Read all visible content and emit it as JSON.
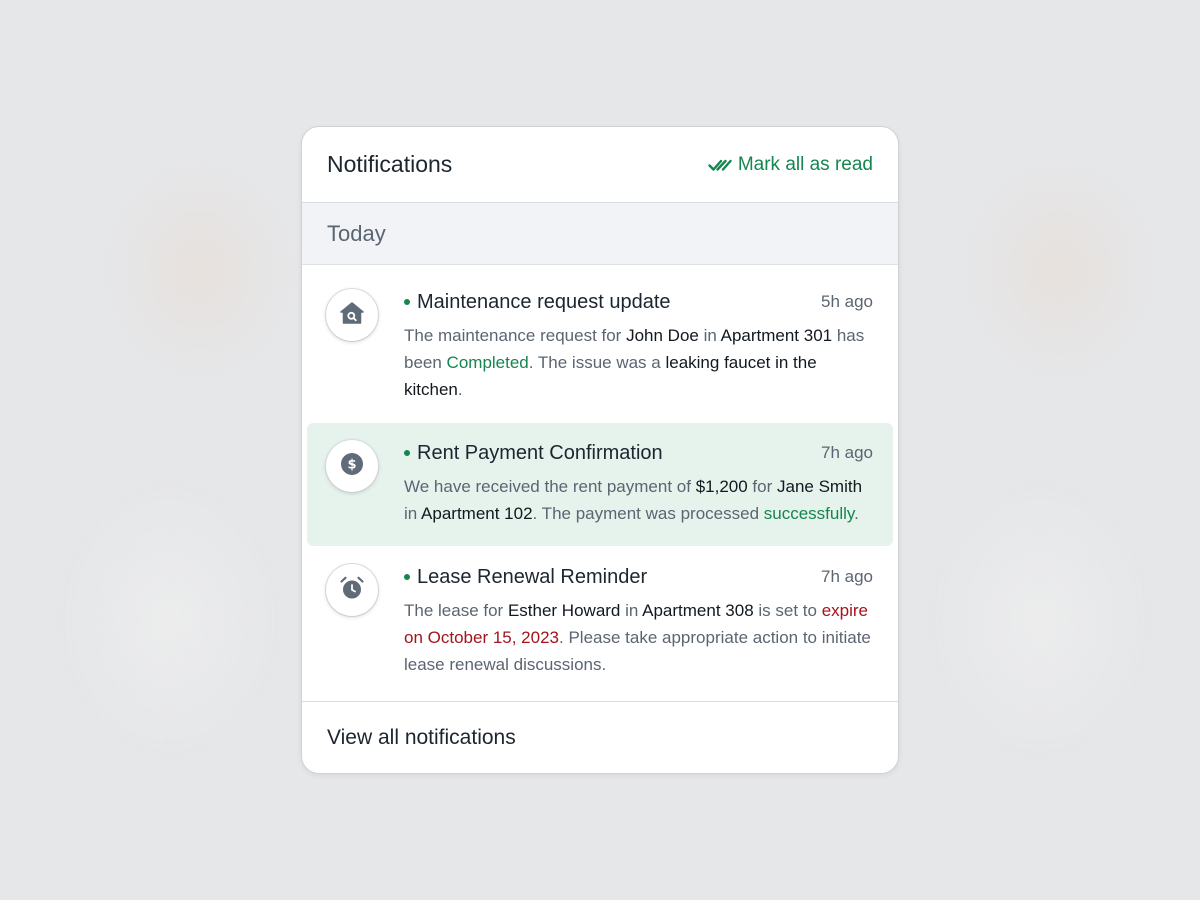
{
  "header": {
    "title": "Notifications",
    "mark_all_label": "Mark all as read"
  },
  "section": {
    "label": "Today"
  },
  "notifications": [
    {
      "icon": "home-search-icon",
      "title": "Maintenance request update",
      "time": "5h ago",
      "unread": true,
      "highlighted": false,
      "body": [
        {
          "text": "The maintenance request for ",
          "style": "normal"
        },
        {
          "text": "John Doe",
          "style": "bold"
        },
        {
          "text": " in ",
          "style": "normal"
        },
        {
          "text": "Apartment 301",
          "style": "bold"
        },
        {
          "text": " has been ",
          "style": "normal"
        },
        {
          "text": "Completed",
          "style": "green"
        },
        {
          "text": ". The issue was a ",
          "style": "normal"
        },
        {
          "text": "leaking faucet in the kitchen",
          "style": "bold"
        },
        {
          "text": ".",
          "style": "normal"
        }
      ]
    },
    {
      "icon": "dollar-coin-icon",
      "title": "Rent Payment Confirmation",
      "time": "7h ago",
      "unread": true,
      "highlighted": true,
      "body": [
        {
          "text": "We have received the rent payment of ",
          "style": "normal"
        },
        {
          "text": "$1,200",
          "style": "bold"
        },
        {
          "text": " for ",
          "style": "normal"
        },
        {
          "text": "Jane Smith",
          "style": "bold"
        },
        {
          "text": " in ",
          "style": "normal"
        },
        {
          "text": "Apartment 102",
          "style": "bold"
        },
        {
          "text": ". The payment was processed ",
          "style": "normal"
        },
        {
          "text": "successfully",
          "style": "green"
        },
        {
          "text": ".",
          "style": "normal"
        }
      ]
    },
    {
      "icon": "alarm-clock-icon",
      "title": "Lease Renewal Reminder",
      "time": "7h ago",
      "unread": true,
      "highlighted": false,
      "body": [
        {
          "text": "The lease for ",
          "style": "normal"
        },
        {
          "text": "Esther Howard",
          "style": "bold"
        },
        {
          "text": " in ",
          "style": "normal"
        },
        {
          "text": "Apartment 308",
          "style": "bold"
        },
        {
          "text": " is set to ",
          "style": "normal"
        },
        {
          "text": "expire on October 15, 2023",
          "style": "red"
        },
        {
          "text": ". Please take appropriate action to initiate lease renewal discussions.",
          "style": "normal"
        }
      ]
    }
  ],
  "footer": {
    "view_all_label": "View all notifications"
  },
  "colors": {
    "accent": "#15864f",
    "danger": "#a3141d",
    "highlight_bg": "#e5f3ec",
    "icon_gray": "#5f6b78"
  }
}
